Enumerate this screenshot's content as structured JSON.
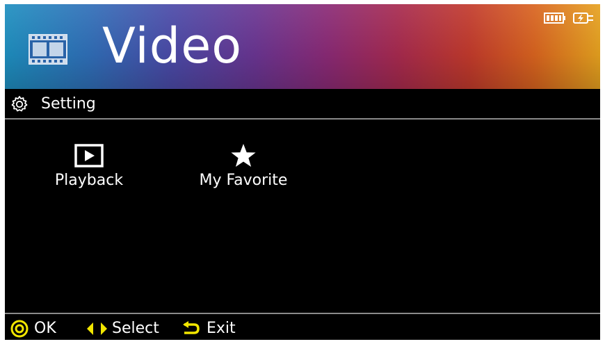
{
  "header": {
    "title": "Video",
    "icon": "film-strip-icon",
    "gradient_colors": [
      "#1e8fc0",
      "#6a3592",
      "#c23a2c",
      "#e6a21f"
    ]
  },
  "status": {
    "battery_icon": "battery-icon",
    "charging_icon": "charging-plug-icon"
  },
  "subheader": {
    "label": "Setting",
    "icon": "gear-icon"
  },
  "menu": {
    "items": [
      {
        "label": "Playback",
        "icon": "play-icon"
      },
      {
        "label": "My Favorite",
        "icon": "star-icon"
      }
    ]
  },
  "footer": {
    "ok_label": "OK",
    "select_label": "Select",
    "exit_label": "Exit",
    "accent_color": "#f2e600"
  }
}
